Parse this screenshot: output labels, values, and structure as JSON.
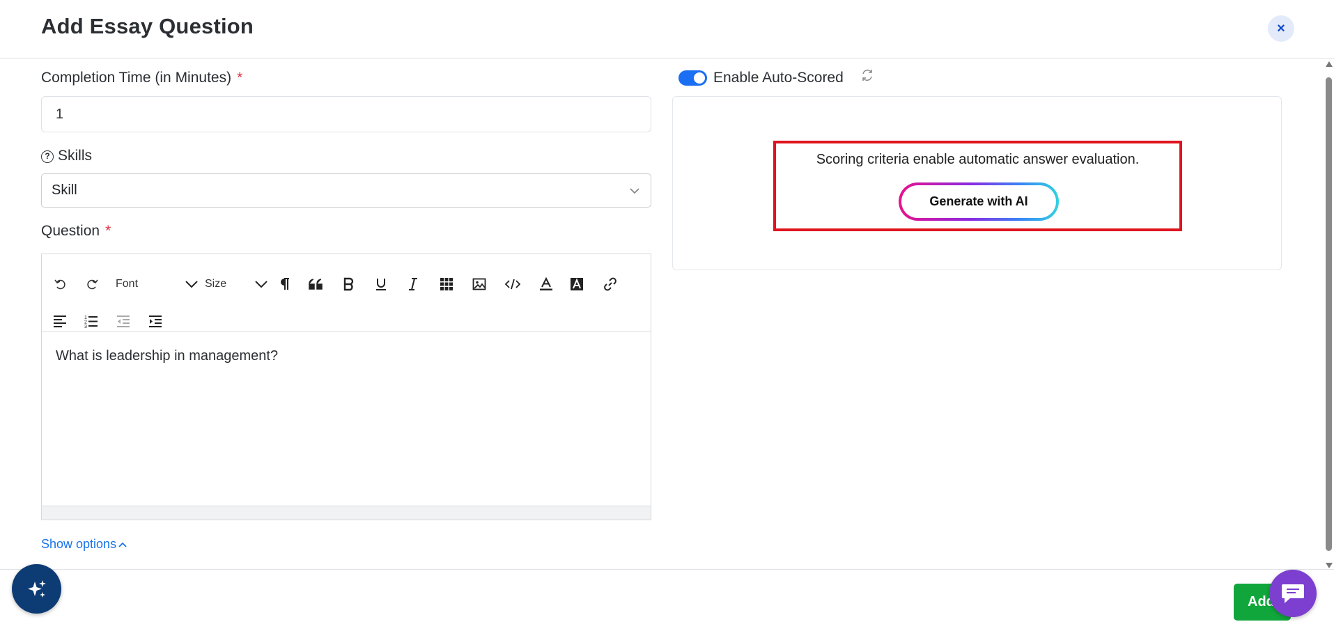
{
  "header": {
    "title": "Add Essay Question",
    "close_glyph": "×",
    "close_icon": "close-icon"
  },
  "form": {
    "completion_time": {
      "label": "Completion Time (in Minutes)",
      "required_mark": "*",
      "value": "1"
    },
    "skills": {
      "label": "Skills",
      "help_glyph": "?",
      "selected": "Skill"
    },
    "question": {
      "label": "Question",
      "required_mark": "*",
      "toolbar": {
        "font_label": "Font",
        "size_label": "Size"
      },
      "content": "What is leadership in management?"
    },
    "show_options": "Show options"
  },
  "auto_score": {
    "toggle_label": "Enable Auto-Scored",
    "enabled": true,
    "criteria_text": "Scoring criteria enable automatic answer evaluation.",
    "generate_button": "Generate with AI"
  },
  "footer": {
    "add_button": "Add"
  },
  "colors": {
    "primary": "#1a6ff2",
    "required": "#dc3545",
    "highlight_border": "#e0141e",
    "add_button": "#11a63b",
    "chat_fab": "#7c3fd0",
    "ai_fab": "#0d3b73"
  }
}
